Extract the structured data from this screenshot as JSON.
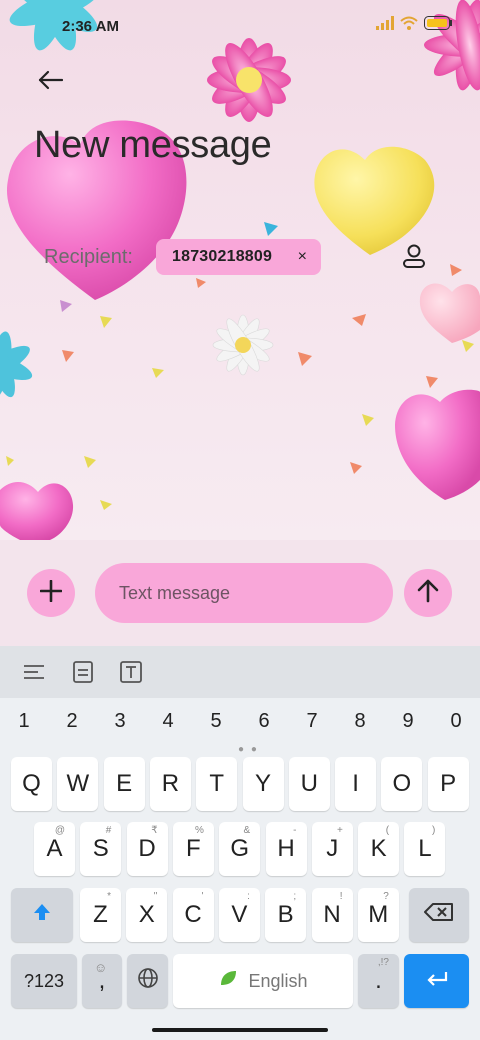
{
  "status_bar": {
    "time": "2:36 AM",
    "battery_color": "#f6c21b"
  },
  "header": {
    "title": "New message",
    "back_icon": "arrow-left-icon"
  },
  "recipient": {
    "label": "Recipient:",
    "chip_value": "18730218809",
    "chip_close": "×",
    "contact_icon": "person-icon"
  },
  "compose": {
    "placeholder": "Text message",
    "attach_icon": "plus-icon",
    "send_icon": "arrow-up-icon"
  },
  "keyboard": {
    "toolbar": [
      "lines-icon",
      "clipboard-icon",
      "text-box-icon"
    ],
    "numbers": [
      "1",
      "2",
      "3",
      "4",
      "5",
      "6",
      "7",
      "8",
      "9",
      "0"
    ],
    "row1": [
      {
        "k": "Q",
        "h": ""
      },
      {
        "k": "W",
        "h": ""
      },
      {
        "k": "E",
        "h": ""
      },
      {
        "k": "R",
        "h": ""
      },
      {
        "k": "T",
        "h": ""
      },
      {
        "k": "Y",
        "h": ""
      },
      {
        "k": "U",
        "h": ""
      },
      {
        "k": "I",
        "h": ""
      },
      {
        "k": "O",
        "h": ""
      },
      {
        "k": "P",
        "h": ""
      }
    ],
    "row2": [
      {
        "k": "A",
        "h": "@"
      },
      {
        "k": "S",
        "h": "#"
      },
      {
        "k": "D",
        "h": "₹"
      },
      {
        "k": "F",
        "h": "%"
      },
      {
        "k": "G",
        "h": "&"
      },
      {
        "k": "H",
        "h": "-"
      },
      {
        "k": "J",
        "h": "+"
      },
      {
        "k": "K",
        "h": "("
      },
      {
        "k": "L",
        "h": ")"
      }
    ],
    "row3": [
      {
        "k": "Z",
        "h": "*"
      },
      {
        "k": "X",
        "h": "\""
      },
      {
        "k": "C",
        "h": "'"
      },
      {
        "k": "V",
        "h": ":"
      },
      {
        "k": "B",
        "h": ";"
      },
      {
        "k": "N",
        "h": "!"
      },
      {
        "k": "M",
        "h": "?"
      }
    ],
    "symbols_label": "?123",
    "comma": ",",
    "space_label": "English",
    "period": ".",
    "period_hint": ",!?",
    "enter_color": "#1b8ef2"
  }
}
